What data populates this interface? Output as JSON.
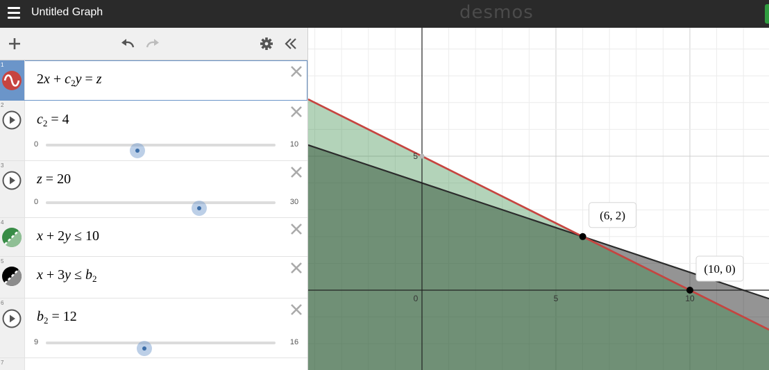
{
  "app": {
    "title": "Untitled Graph",
    "brand": "desmos"
  },
  "colors": {
    "red": "#c74440",
    "green": "#388c46",
    "black": "#000000",
    "blue": "#6b95c9",
    "topbar": "#2a2a2a"
  },
  "icons": [
    "menu-icon",
    "add-icon",
    "undo-icon",
    "redo-icon",
    "settings-icon",
    "collapse-icon",
    "delete-icon",
    "play-icon"
  ],
  "expressions": [
    {
      "index": "1",
      "kind": "equation",
      "parts": [
        "2",
        "x",
        "+",
        "c",
        "2",
        "y",
        "=",
        "z"
      ]
    },
    {
      "index": "2",
      "kind": "slider",
      "name": "c",
      "sub": "2",
      "eq": "=",
      "value": "4",
      "min": "0",
      "max": "10",
      "position": 0.4
    },
    {
      "index": "3",
      "kind": "slider",
      "name": "z",
      "eq": "=",
      "value": "20",
      "min": "0",
      "max": "30",
      "position": 0.667
    },
    {
      "index": "4",
      "kind": "inequality",
      "parts": [
        "x",
        "+",
        "2",
        "y",
        "≤",
        "10"
      ]
    },
    {
      "index": "5",
      "kind": "inequality",
      "parts": [
        "x",
        "+",
        "3",
        "y",
        "≤",
        "b",
        "2"
      ]
    },
    {
      "index": "6",
      "kind": "slider",
      "name": "b",
      "sub": "2",
      "eq": "=",
      "value": "12",
      "min": "9",
      "max": "16",
      "position": 0.429
    },
    {
      "index": "7",
      "kind": "empty"
    }
  ],
  "graph": {
    "x_ticks": [
      "0",
      "5",
      "10"
    ],
    "y_ticks": [
      "5"
    ],
    "points": [
      {
        "label": "(6, 2)",
        "x": 6,
        "y": 2
      },
      {
        "label": "(10, 0)",
        "x": 10,
        "y": 0
      }
    ]
  }
}
